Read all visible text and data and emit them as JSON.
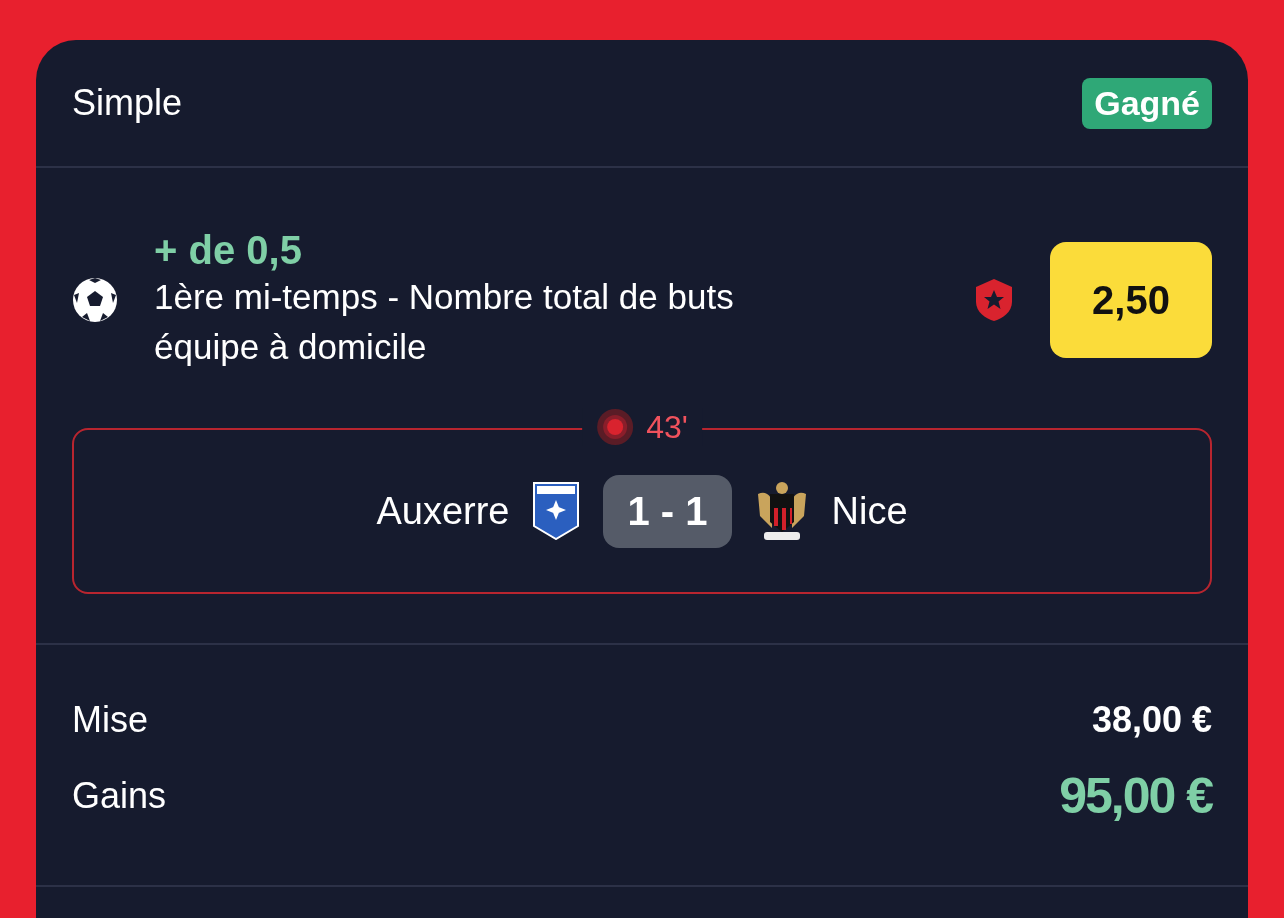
{
  "bet_type": "Simple",
  "status": {
    "label": "Gagné",
    "kind": "won"
  },
  "selection": {
    "pick": "+ de 0,5",
    "market": "1ère mi-temps - Nombre total de buts équipe à domicile",
    "boosted": true,
    "odds": "2,50"
  },
  "match": {
    "live": true,
    "minute": "43'",
    "home": "Auxerre",
    "score": "1 - 1",
    "away": "Nice"
  },
  "amounts": [
    {
      "label": "Mise",
      "value": "38,00 €",
      "kind": "stake"
    },
    {
      "label": "Gains",
      "value": "95,00 €",
      "kind": "winnings"
    }
  ]
}
